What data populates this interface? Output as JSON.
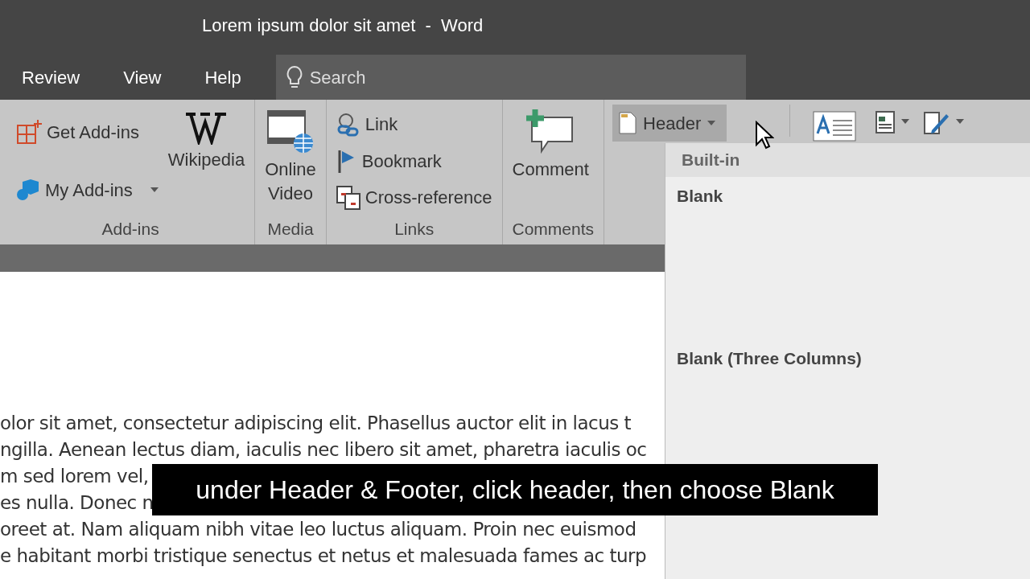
{
  "window": {
    "title": "Lorem ipsum dolor sit amet  -  Word"
  },
  "tabs": [
    {
      "label": "Review",
      "selected": false
    },
    {
      "label": "View",
      "selected": false
    },
    {
      "label": "Help",
      "selected": false
    }
  ],
  "search": {
    "placeholder": "Search"
  },
  "ribbon": {
    "groups": [
      {
        "label": "Add-ins",
        "items": [
          {
            "kind": "small",
            "label": "Get Add-ins",
            "dropdown": false
          },
          {
            "kind": "small",
            "label": "My Add-ins",
            "dropdown": true
          },
          {
            "kind": "large",
            "label": "Wikipedia"
          }
        ]
      },
      {
        "label": "Media",
        "items": [
          {
            "kind": "large",
            "label": "Online\nVideo"
          }
        ]
      },
      {
        "label": "Links",
        "items": [
          {
            "kind": "small",
            "label": "Link",
            "dropdown": false
          },
          {
            "kind": "small",
            "label": "Bookmark",
            "dropdown": false
          },
          {
            "kind": "small",
            "label": "Cross-reference",
            "dropdown": false
          }
        ]
      },
      {
        "label": "Comments",
        "items": [
          {
            "kind": "large",
            "label": "Comment"
          }
        ]
      }
    ],
    "header_button": {
      "label": "Header",
      "pressed": true
    }
  },
  "dropdown": {
    "section": "Built-in",
    "items": [
      "Blank",
      "Blank (Three Columns)"
    ]
  },
  "document": {
    "lines": [
      "olor sit amet, consectetur adipiscing elit. Phasellus auctor elit in lacus t",
      "ngilla. Aenean lectus diam, iaculis nec libero sit amet, pharetra iaculis oc",
      "m sed lorem vel,",
      "es nulla. Donec n",
      "oreet at. Nam aliquam nibh vitae leo luctus aliquam. Proin nec euismod",
      "e habitant morbi tristique senectus et netus et malesuada fames ac turp"
    ]
  },
  "caption": "under Header & Footer, click header, then choose Blank"
}
